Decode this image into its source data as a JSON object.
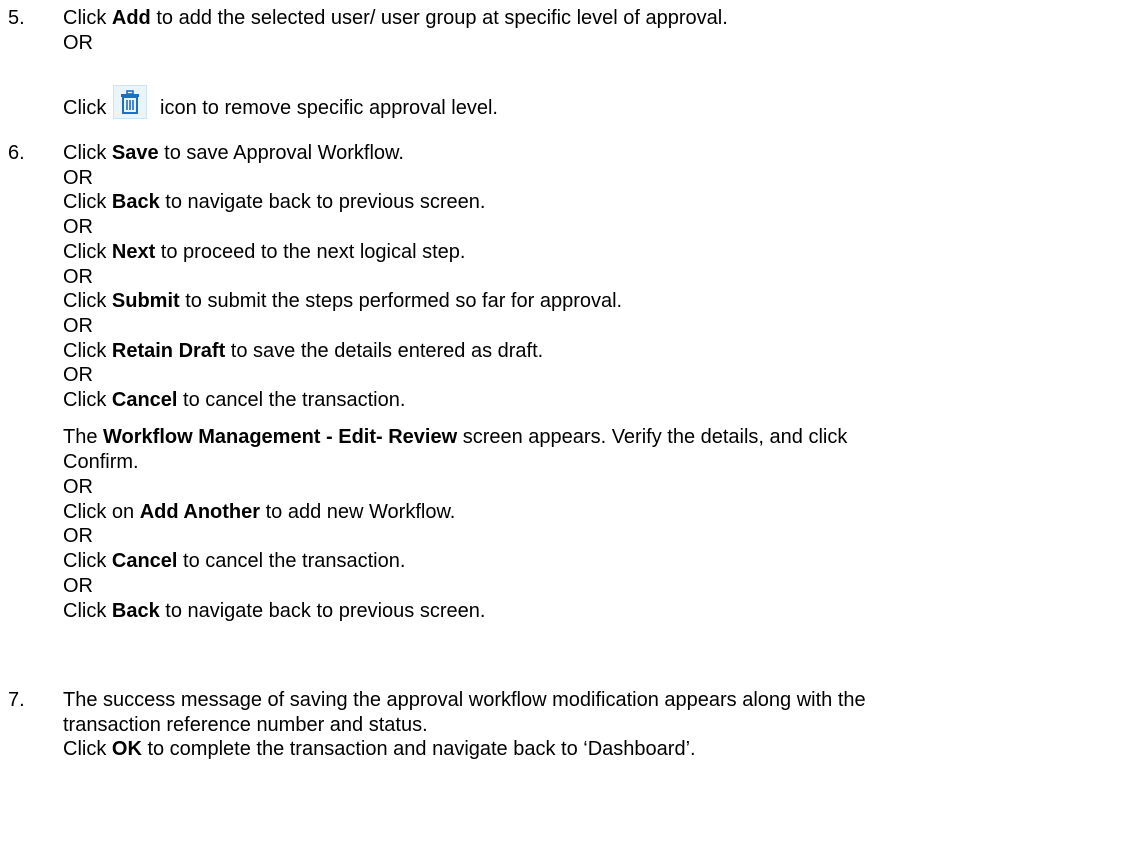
{
  "step5": {
    "number": "5.",
    "line1": {
      "pre": "Click ",
      "bold": "Add",
      "post": " to add the selected user/ user group at specific level of approval."
    },
    "or1": "OR",
    "line2": {
      "pre": "Click",
      "post": "icon to remove specific approval level."
    },
    "icon": "trash-icon"
  },
  "step6": {
    "number": "6.",
    "items": [
      {
        "pre": "Click ",
        "bold": "Save",
        "post": " to save Approval Workflow."
      },
      {
        "or": "OR"
      },
      {
        "pre": "Click ",
        "bold": "Back",
        "post": " to navigate back to previous screen."
      },
      {
        "or": "OR"
      },
      {
        "pre": "Click ",
        "bold": "Next",
        "post": " to proceed to the next logical step."
      },
      {
        "or": "OR"
      },
      {
        "pre": "Click ",
        "bold": "Submit",
        "post": " to submit the steps performed so far for approval."
      },
      {
        "or": "OR"
      },
      {
        "pre": "Click ",
        "bold": "Retain Draft",
        "post": " to save the details entered as draft."
      },
      {
        "or": "OR"
      },
      {
        "pre": "Click ",
        "bold": "Cancel",
        "post": " to cancel the transaction."
      }
    ],
    "review": {
      "pre": "The ",
      "bold": "Workflow Management - Edit- Review",
      "post": " screen appears. Verify the details, and click",
      "cont": "Confirm."
    },
    "review_items": [
      {
        "or": "OR"
      },
      {
        "pre": "Click on ",
        "bold": "Add Another",
        "post": " to add new Workflow."
      },
      {
        "or": "OR"
      },
      {
        "pre": "Click ",
        "bold": "Cancel",
        "post": " to cancel the transaction."
      },
      {
        "or": "OR"
      },
      {
        "pre": "Click ",
        "bold": "Back",
        "post": " to navigate back to previous screen."
      }
    ]
  },
  "step7": {
    "number": "7.",
    "line1": "The success message of saving the approval workflow modification appears along with the",
    "line2": "transaction reference number and status.",
    "line3": {
      "pre": "Click ",
      "bold": "OK",
      "post": " to complete the transaction and navigate back to ‘Dashboard’."
    }
  }
}
